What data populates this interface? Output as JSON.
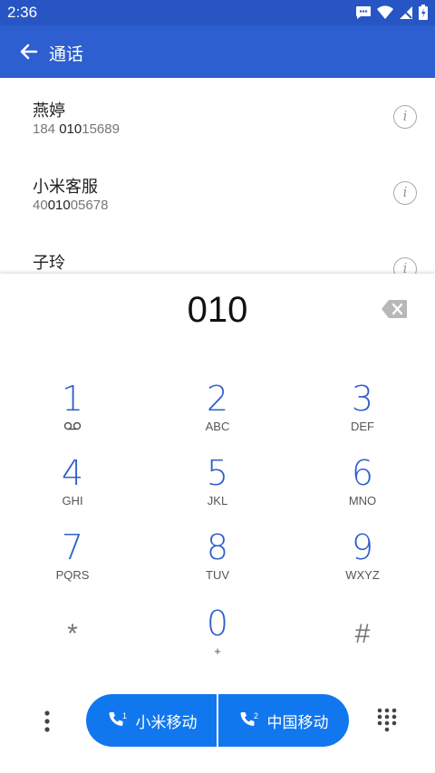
{
  "status_bar": {
    "time": "2:36"
  },
  "app_bar": {
    "title": "通话"
  },
  "contacts": [
    {
      "name": "燕婷",
      "number_pre": "184 ",
      "number_match": "010",
      "number_post": "15689"
    },
    {
      "name": "小米客服",
      "number_pre": "40",
      "number_match": "010",
      "number_post": "05678"
    },
    {
      "name": "子玲",
      "number_pre": "",
      "number_match": "",
      "number_post": ""
    }
  ],
  "dialpad": {
    "input": "010",
    "keys": [
      {
        "digit": "1",
        "letters": ""
      },
      {
        "digit": "2",
        "letters": "ABC"
      },
      {
        "digit": "3",
        "letters": "DEF"
      },
      {
        "digit": "4",
        "letters": "GHI"
      },
      {
        "digit": "5",
        "letters": "JKL"
      },
      {
        "digit": "6",
        "letters": "MNO"
      },
      {
        "digit": "7",
        "letters": "PQRS"
      },
      {
        "digit": "8",
        "letters": "TUV"
      },
      {
        "digit": "9",
        "letters": "WXYZ"
      },
      {
        "digit": "*",
        "letters": ""
      },
      {
        "digit": "0",
        "letters": "+"
      },
      {
        "digit": "#",
        "letters": ""
      }
    ]
  },
  "call_buttons": {
    "sim1_label": "小米移动",
    "sim1_index": "1",
    "sim2_label": "中国移动",
    "sim2_index": "2"
  },
  "colors": {
    "status_bar": "#2756c4",
    "app_bar": "#2e5fd0",
    "accent": "#2f5fcc",
    "call_button": "#1177ee"
  },
  "icons": [
    "back-arrow-icon",
    "info-icon",
    "backspace-icon",
    "voicemail-icon",
    "phone-icon",
    "more-vertical-icon",
    "dialpad-icon"
  ]
}
